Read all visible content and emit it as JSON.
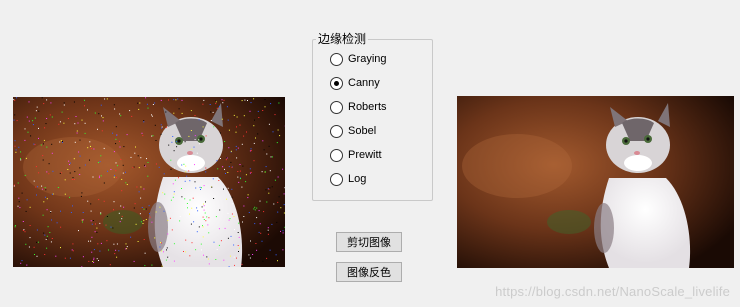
{
  "group": {
    "title": "边缘检测",
    "options": [
      {
        "label": "Graying",
        "checked": false
      },
      {
        "label": "Canny",
        "checked": true
      },
      {
        "label": "Roberts",
        "checked": false
      },
      {
        "label": "Sobel",
        "checked": false
      },
      {
        "label": "Prewitt",
        "checked": false
      },
      {
        "label": "Log",
        "checked": false
      }
    ]
  },
  "buttons": {
    "crop_label": "剪切图像",
    "invert_label": "图像反色"
  },
  "watermark": "https://blog.csdn.net/NanoScale_livelife"
}
